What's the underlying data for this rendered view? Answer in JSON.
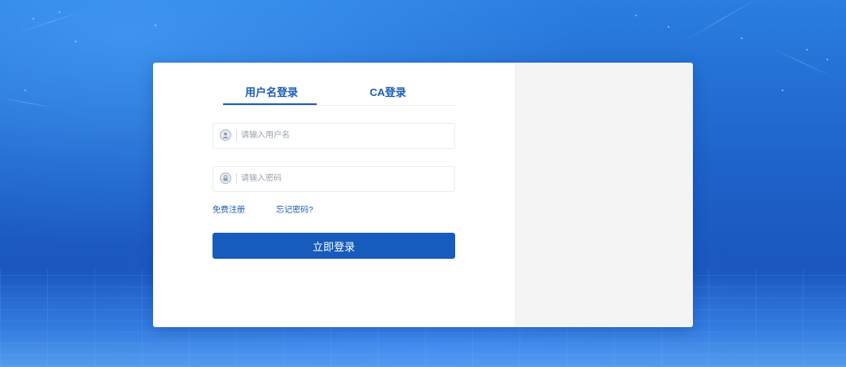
{
  "login": {
    "tabs": [
      {
        "label": "用户名登录",
        "active": true
      },
      {
        "label": "CA登录",
        "active": false
      }
    ],
    "username": {
      "placeholder": "请输入用户名",
      "value": "",
      "icon": "user-icon"
    },
    "password": {
      "placeholder": "请输入密码",
      "value": "",
      "icon": "lock-icon"
    },
    "register_link": "免费注册",
    "forgot_link": "忘记密码?",
    "submit_label": "立即登录"
  },
  "colors": {
    "accent": "#1a5cb5",
    "button": "#175cbc",
    "right_panel": "#f4f4f4",
    "background": "#1e62c9"
  }
}
